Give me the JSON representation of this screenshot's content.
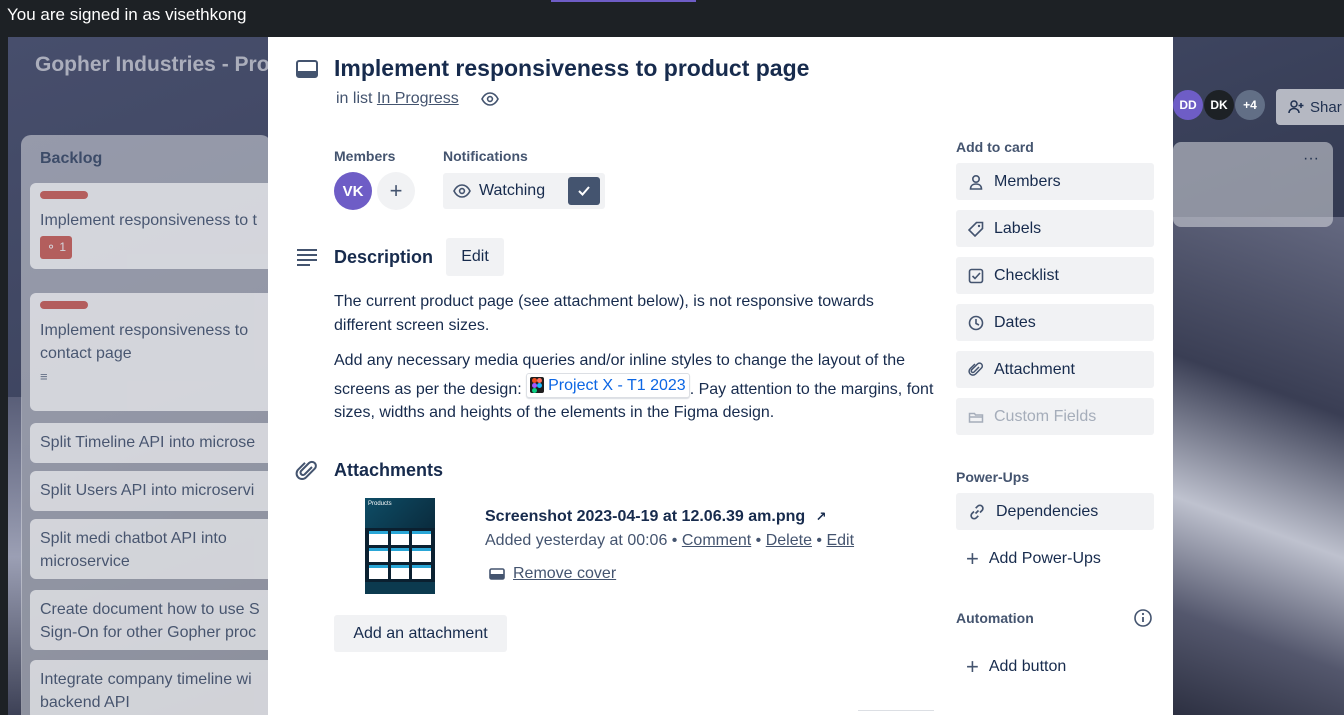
{
  "signin": {
    "text": "You are signed in as visethkong"
  },
  "board": {
    "title": "Gopher Industries - Pro",
    "avatars": [
      {
        "initials": "DD",
        "color": "#6e5dc6"
      },
      {
        "initials": "DK",
        "color": "#1d2125"
      },
      {
        "initials": "+4",
        "color": "#626f86"
      }
    ],
    "share_label": "Shar",
    "list_title": "Backlog",
    "cards": [
      {
        "text": "Implement responsiveness to t",
        "badge": "1"
      },
      {
        "text": "Implement responsiveness to contact page"
      },
      {
        "text": "Split Timeline API into microse"
      },
      {
        "text": "Split Users API into microservi"
      },
      {
        "text": "Split medi chatbot API into microservice"
      },
      {
        "text": "Create document how to use S Sign-On for other Gopher proc"
      },
      {
        "text": "Integrate company timeline wi backend API"
      }
    ]
  },
  "modal": {
    "title": "Implement responsiveness to product page",
    "in_list_prefix": "in list",
    "list_name": "In Progress",
    "members_label": "Members",
    "member_initials": "VK",
    "notifications_label": "Notifications",
    "watch_label": "Watching",
    "description_label": "Description",
    "edit_label": "Edit",
    "desc_p1": "The current product page (see attachment below), is not responsive towards different screen sizes.",
    "desc_p2_before": "Add any necessary media queries and/or inline styles to change the layout of the screens as per the design:",
    "desc_link": "Project X - T1 2023",
    "desc_p2_after": ". Pay attention to the margins, font sizes, widths and heights of the elements in the Figma design.",
    "attachments_label": "Attachments",
    "attachment": {
      "name": "Screenshot 2023-04-19 at 12.06.39 am.png",
      "added": "Added yesterday at 00:06",
      "comment": "Comment",
      "delete": "Delete",
      "edit": "Edit",
      "remove_cover": "Remove cover",
      "thumb_title": "Products"
    },
    "add_attachment_label": "Add an attachment"
  },
  "sidebar": {
    "add_to_card_label": "Add to card",
    "buttons": [
      {
        "label": "Members",
        "icon": "person-icon"
      },
      {
        "label": "Labels",
        "icon": "tag-icon"
      },
      {
        "label": "Checklist",
        "icon": "checklist-icon"
      },
      {
        "label": "Dates",
        "icon": "clock-icon"
      },
      {
        "label": "Attachment",
        "icon": "paperclip-icon"
      },
      {
        "label": "Custom Fields",
        "icon": "custom-fields-icon"
      }
    ],
    "power_ups_label": "Power-Ups",
    "dependencies_label": "Dependencies",
    "add_power_ups_label": "Add Power-Ups",
    "automation_label": "Automation",
    "add_button_label": "Add button"
  }
}
